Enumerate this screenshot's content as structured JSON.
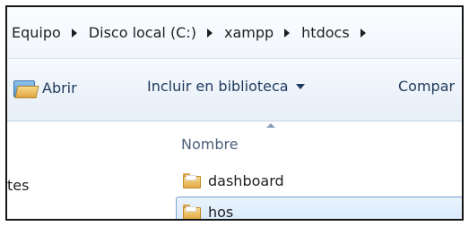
{
  "breadcrumbs": [
    {
      "label": "Equipo"
    },
    {
      "label": "Disco local (C:)"
    },
    {
      "label": "xampp"
    },
    {
      "label": "htdocs"
    }
  ],
  "toolbar": {
    "open_label": "Abrir",
    "include_label": "Incluir en biblioteca",
    "share_label": "Compar"
  },
  "nav_pane": {
    "item_label": "tes"
  },
  "file_list": {
    "column_header": "Nombre",
    "rows": [
      {
        "name": "dashboard",
        "selected": false
      },
      {
        "name": "hos",
        "selected": true
      }
    ]
  }
}
